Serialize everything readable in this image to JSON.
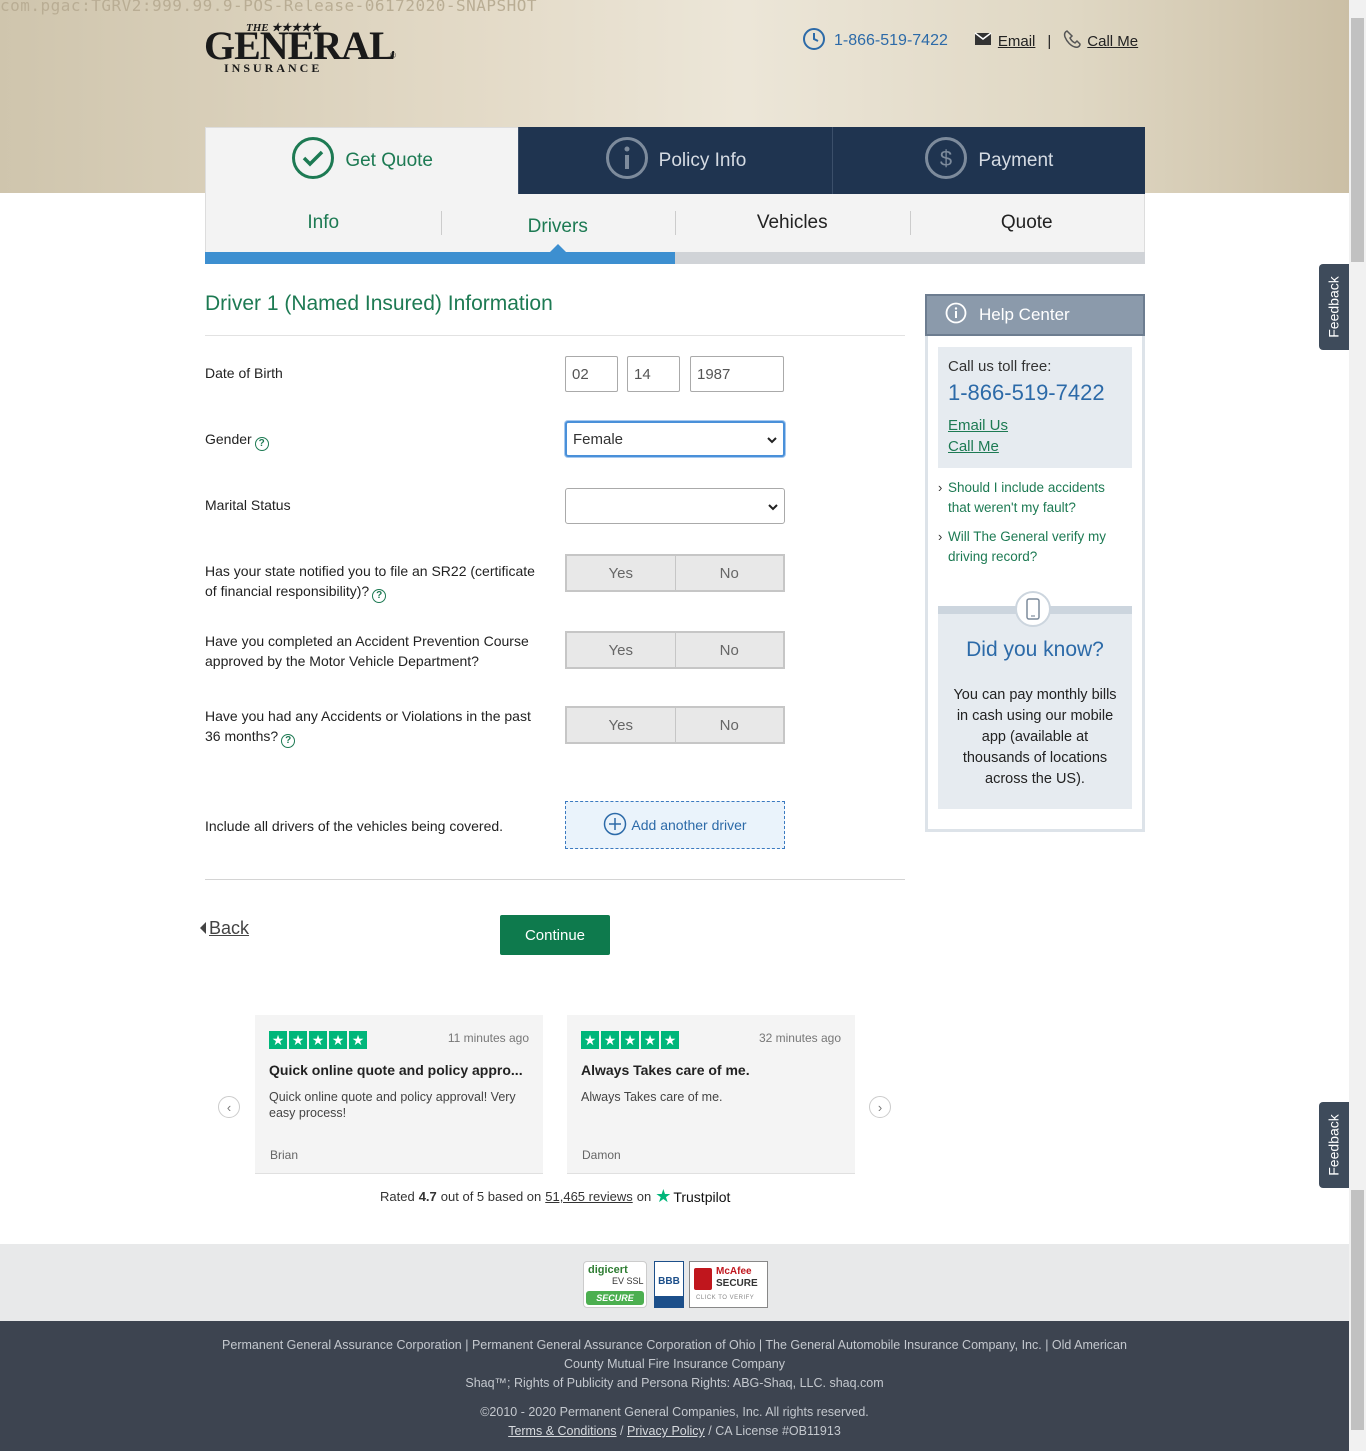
{
  "debug_banner": "com.pgac:TGRV2:999.99.9-POS-Release-06172020-SNAPSHOT",
  "header": {
    "logo_top": "THE ★★★★★",
    "logo_main": "GENERAL",
    "logo_bottom": "INSURANCE",
    "phone": "1-866-519-7422",
    "email_label": "Email",
    "separator": "|",
    "call_me_label": "Call Me"
  },
  "steps": [
    {
      "label": "Get Quote",
      "icon": "check-circle-icon"
    },
    {
      "label": "Policy Info",
      "icon": "info-circle-icon"
    },
    {
      "label": "Payment",
      "icon": "dollar-circle-icon"
    }
  ],
  "subtabs": [
    {
      "label": "Info"
    },
    {
      "label": "Drivers"
    },
    {
      "label": "Vehicles"
    },
    {
      "label": "Quote"
    }
  ],
  "progress": {
    "fraction": 0.5,
    "fill_color": "#3d8fd0"
  },
  "form": {
    "title": "Driver 1 (Named Insured) Information",
    "dob_label": "Date of Birth",
    "dob_month": "02",
    "dob_day": "14",
    "dob_year": "1987",
    "gender_label": "Gender",
    "gender_value": "Female",
    "marital_label": "Marital Status",
    "marital_value": "",
    "sr22_label": "Has your state notified you to file an SR22 (certificate of financial responsibility)?",
    "course_label": "Have you completed an Accident Prevention Course approved by the Motor Vehicle Department?",
    "accidents_label": "Have you had any Accidents or Violations in the past 36 months?",
    "yes_label": "Yes",
    "no_label": "No",
    "include_label": "Include all drivers of the vehicles being covered.",
    "add_driver_label": "Add another driver",
    "back_label": "Back",
    "continue_label": "Continue"
  },
  "help_center": {
    "title": "Help Center",
    "call_label": "Call us toll free:",
    "phone": "1-866-519-7422",
    "email_us": "Email Us",
    "call_me": "Call Me",
    "faq": [
      "Should I include accidents that weren't my fault?",
      "Will The General verify my driving record?"
    ],
    "dyk_title": "Did you know?",
    "dyk_text": "You can pay monthly bills in cash using our mobile app (available at thousands of locations across the US)."
  },
  "feedback_label": "Feedback",
  "reviews": [
    {
      "rating": 5,
      "time": "11 minutes ago",
      "title": "Quick online quote and policy appro...",
      "body": "Quick online quote and policy approval! Very easy process!",
      "author": "Brian"
    },
    {
      "rating": 5,
      "time": "32 minutes ago",
      "title": "Always Takes care of me.",
      "body": "Always Takes care of me.",
      "author": "Damon"
    }
  ],
  "trustpilot": {
    "prefix": "Rated",
    "score": "4.7",
    "middle": "out of 5 based on",
    "reviews_link": "51,465 reviews",
    "on": "on",
    "brand": "Trustpilot"
  },
  "badges": {
    "digicert_top": "digicert",
    "digicert_mid": "EV SSL",
    "digicert_bottom": "SECURE",
    "bbb": "BBB",
    "mcafee_top": "McAfee",
    "mcafee_bottom": "SECURE",
    "mcafee_small": "CLICK TO VERIFY"
  },
  "footer": {
    "line1": "Permanent General Assurance Corporation | Permanent General Assurance Corporation of Ohio | The General Automobile Insurance Company, Inc. | Old American",
    "line2": "County Mutual Fire Insurance Company",
    "line3": "Shaq™; Rights of Publicity and Persona Rights: ABG-Shaq, LLC. shaq.com",
    "copyright": "©2010 - 2020 Permanent General Companies, Inc. All rights reserved.",
    "terms": "Terms & Conditions",
    "sep1": "/",
    "privacy": "Privacy Policy",
    "license": "/ CA License #OB11913"
  }
}
